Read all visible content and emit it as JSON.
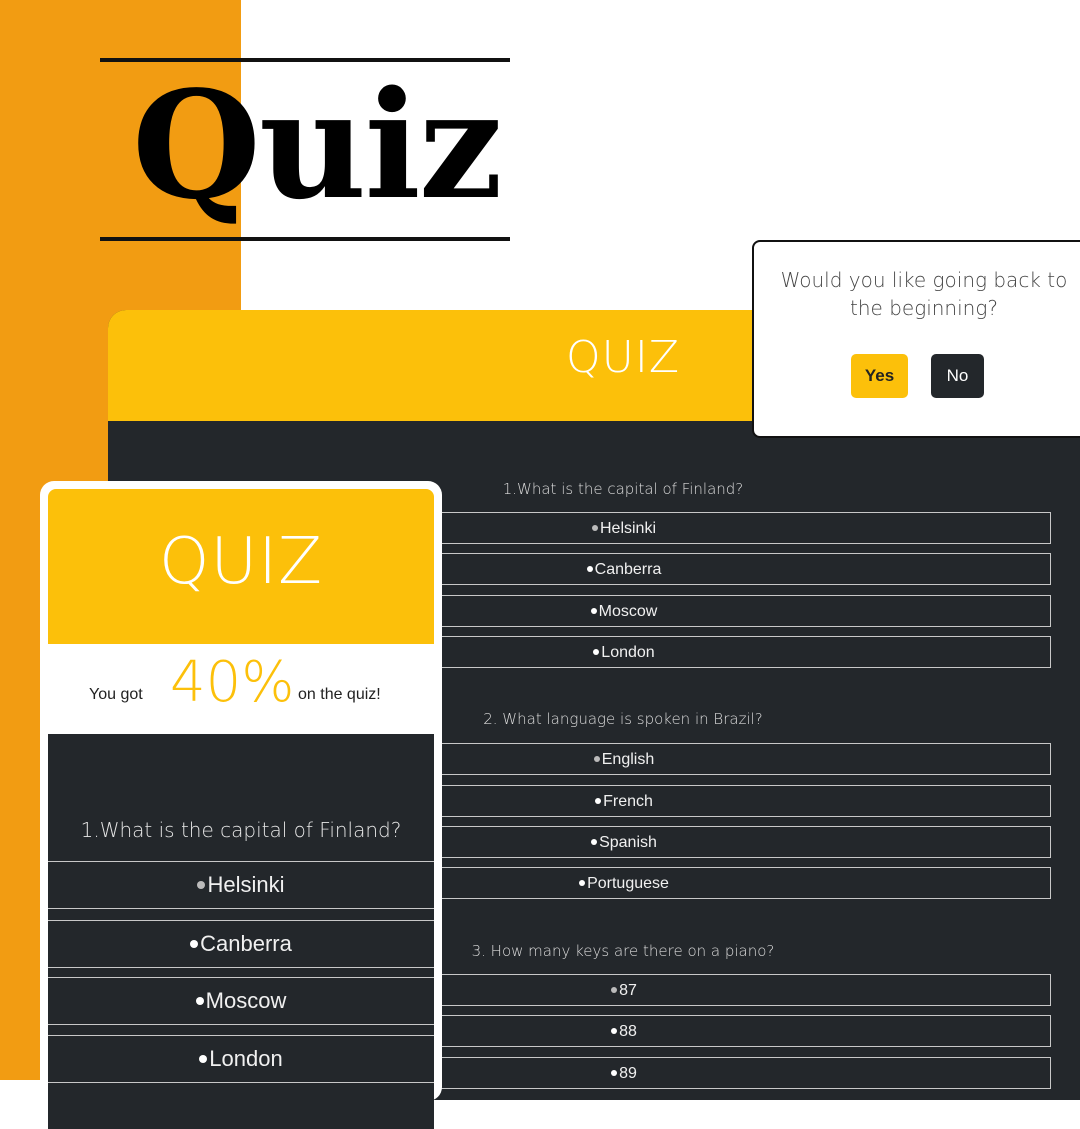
{
  "brand": {
    "title": "Quiz"
  },
  "main": {
    "header": "QUIZ",
    "questions": [
      {
        "text": "1.What is the capital of Finland?",
        "options": [
          "Helsinki",
          "Canberra",
          "Moscow",
          "London"
        ]
      },
      {
        "text": "2. What language is spoken in Brazil?",
        "options": [
          "English",
          "French",
          "Spanish",
          "Portuguese"
        ]
      },
      {
        "text": "3. How many keys are there on a piano?",
        "options": [
          "87",
          "88",
          "89"
        ]
      }
    ]
  },
  "result": {
    "header": "QUIZ",
    "score_prefix": "You got",
    "score_value": "40%",
    "score_suffix": "on the quiz!",
    "question": "1.What is the capital of Finland?",
    "options": [
      "Helsinki",
      "Canberra",
      "Moscow",
      "London"
    ]
  },
  "modal": {
    "message": "Would you like going back to the beginning?",
    "yes_label": "Yes",
    "no_label": "No"
  },
  "colors": {
    "accent": "#fcc00a",
    "orange": "#f29c12",
    "dark": "#23272b"
  }
}
